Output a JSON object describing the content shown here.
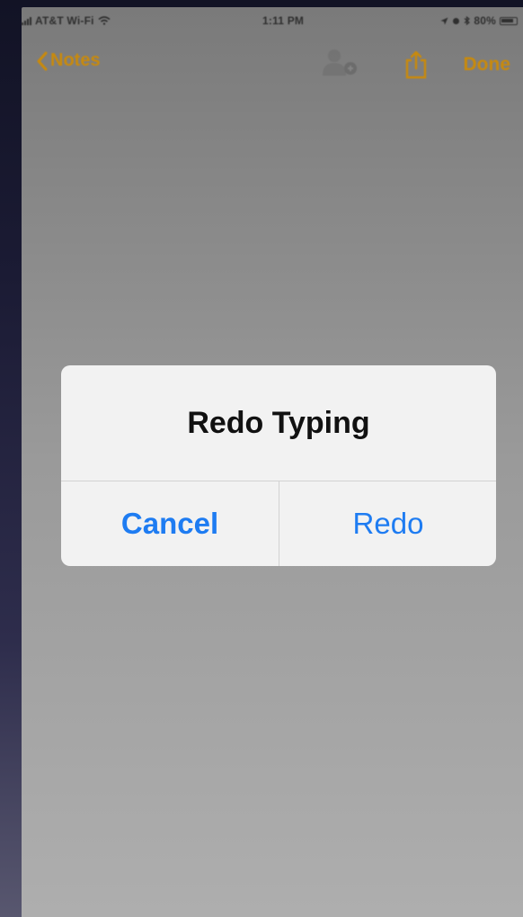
{
  "status_bar": {
    "carrier": "AT&T Wi-Fi",
    "time": "1:11 PM",
    "battery": "80%"
  },
  "nav": {
    "back_label": "Notes",
    "done_label": "Done"
  },
  "alert": {
    "title": "Redo Typing",
    "cancel_label": "Cancel",
    "redo_label": "Redo"
  },
  "colors": {
    "accent_gold": "#c98a0c",
    "ios_blue": "#1e7cf2",
    "dim_overlay": "#9a9a9a",
    "alert_bg": "#f2f2f2"
  },
  "icons": [
    "signal-icon",
    "wifi-icon",
    "location-icon",
    "alarm-icon",
    "bluetooth-icon",
    "battery-icon",
    "back-chevron-icon",
    "add-people-icon",
    "share-icon"
  ]
}
